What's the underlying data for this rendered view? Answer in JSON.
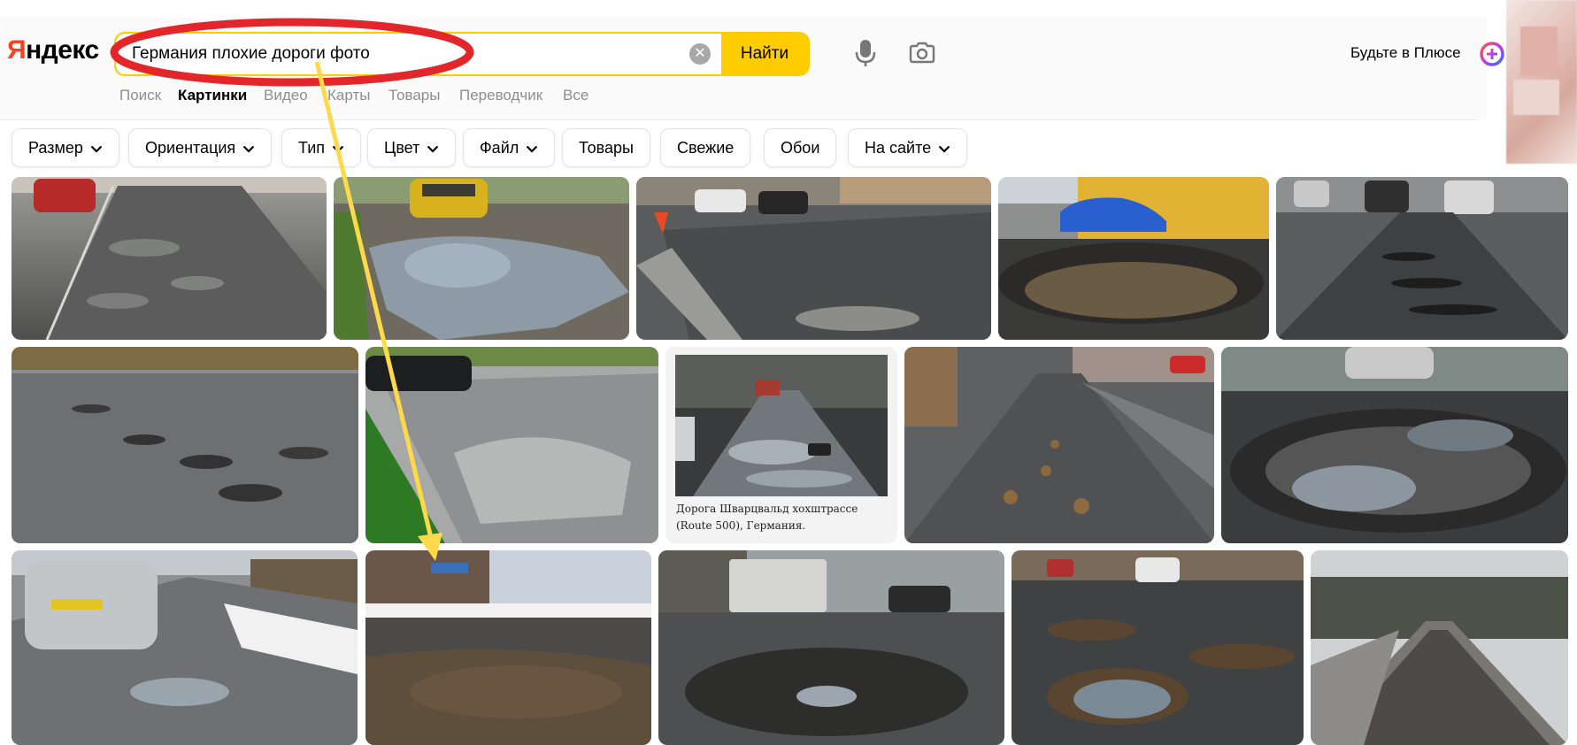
{
  "logo": {
    "first_letter": "Я",
    "rest": "ндекс"
  },
  "search": {
    "value": "Германия плохие дороги фото",
    "clear_symbol": "✕",
    "button_label": "Найти"
  },
  "header": {
    "plus_label": "Будьте в Плюсе"
  },
  "icons": {
    "microphone": "microphone-icon",
    "camera": "camera-search-icon",
    "clear": "clear-icon",
    "plus": "plus-logo-icon",
    "chevron": "chevron-down-icon"
  },
  "nav": {
    "items": [
      {
        "label": "Поиск",
        "active": false
      },
      {
        "label": "Картинки",
        "active": true
      },
      {
        "label": "Видео",
        "active": false
      },
      {
        "label": "Карты",
        "active": false
      },
      {
        "label": "Товары",
        "active": false
      },
      {
        "label": "Переводчик",
        "active": false
      },
      {
        "label": "Все",
        "active": false
      }
    ]
  },
  "filters": [
    {
      "label": "Размер",
      "dropdown": true
    },
    {
      "label": "Ориентация",
      "dropdown": true
    },
    {
      "label": "Тип",
      "dropdown": true
    },
    {
      "label": "Цвет",
      "dropdown": true
    },
    {
      "label": "Файл",
      "dropdown": true
    },
    {
      "label": "Товары",
      "dropdown": false
    },
    {
      "label": "Свежие",
      "dropdown": false
    },
    {
      "label": "Обои",
      "dropdown": false
    },
    {
      "label": "На сайте",
      "dropdown": true
    }
  ],
  "results": {
    "caption": "Дорога Шварцвальд хохштрассе (Route 500), Германия."
  },
  "colors": {
    "brand_yellow": "#ffcc00",
    "logo_red": "#fc3f1d",
    "annotation_red": "#e3262a",
    "annotation_yellow": "#ffd94a"
  }
}
